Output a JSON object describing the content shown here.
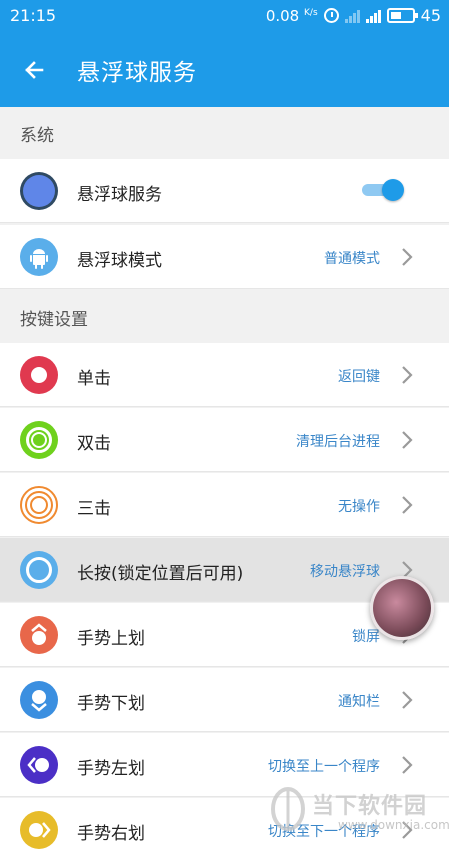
{
  "status_bar": {
    "time": "21:15",
    "net_speed": "0.08",
    "net_unit": "K/s",
    "battery": "45",
    "icons": [
      "alarm-icon",
      "signal-icon",
      "signal-icon",
      "battery-icon"
    ]
  },
  "app_bar": {
    "title": "悬浮球服务",
    "back_icon": "arrow-left-icon"
  },
  "sections": [
    {
      "header": "系统",
      "rows": [
        {
          "label": "悬浮球服务",
          "icon": "floating-ball-service-icon",
          "toggle": true
        },
        {
          "label": "悬浮球模式",
          "value": "普通模式",
          "icon": "android-icon"
        }
      ]
    },
    {
      "header": "按键设置",
      "rows": [
        {
          "label": "单击",
          "value": "返回键",
          "icon": "single-tap-icon"
        },
        {
          "label": "双击",
          "value": "清理后台进程",
          "icon": "double-tap-icon"
        },
        {
          "label": "三击",
          "value": "无操作",
          "icon": "triple-tap-icon"
        },
        {
          "label": "长按(锁定位置后可用)",
          "value": "移动悬浮球",
          "icon": "long-press-icon"
        },
        {
          "label": "手势上划",
          "value": "锁屏",
          "icon": "swipe-up-icon"
        },
        {
          "label": "手势下划",
          "value": "通知栏",
          "icon": "swipe-down-icon"
        },
        {
          "label": "手势左划",
          "value": "切换至上一个程序",
          "icon": "swipe-left-icon"
        },
        {
          "label": "手势右划",
          "value": "切换至下一个程序",
          "icon": "swipe-right-icon"
        }
      ]
    }
  ],
  "watermark": {
    "text": "当下软件园",
    "url": "www.downxia.com"
  },
  "colors": {
    "accent": "#1e9be8",
    "value_text": "#3a86c8",
    "background": "#f1f1f1"
  }
}
